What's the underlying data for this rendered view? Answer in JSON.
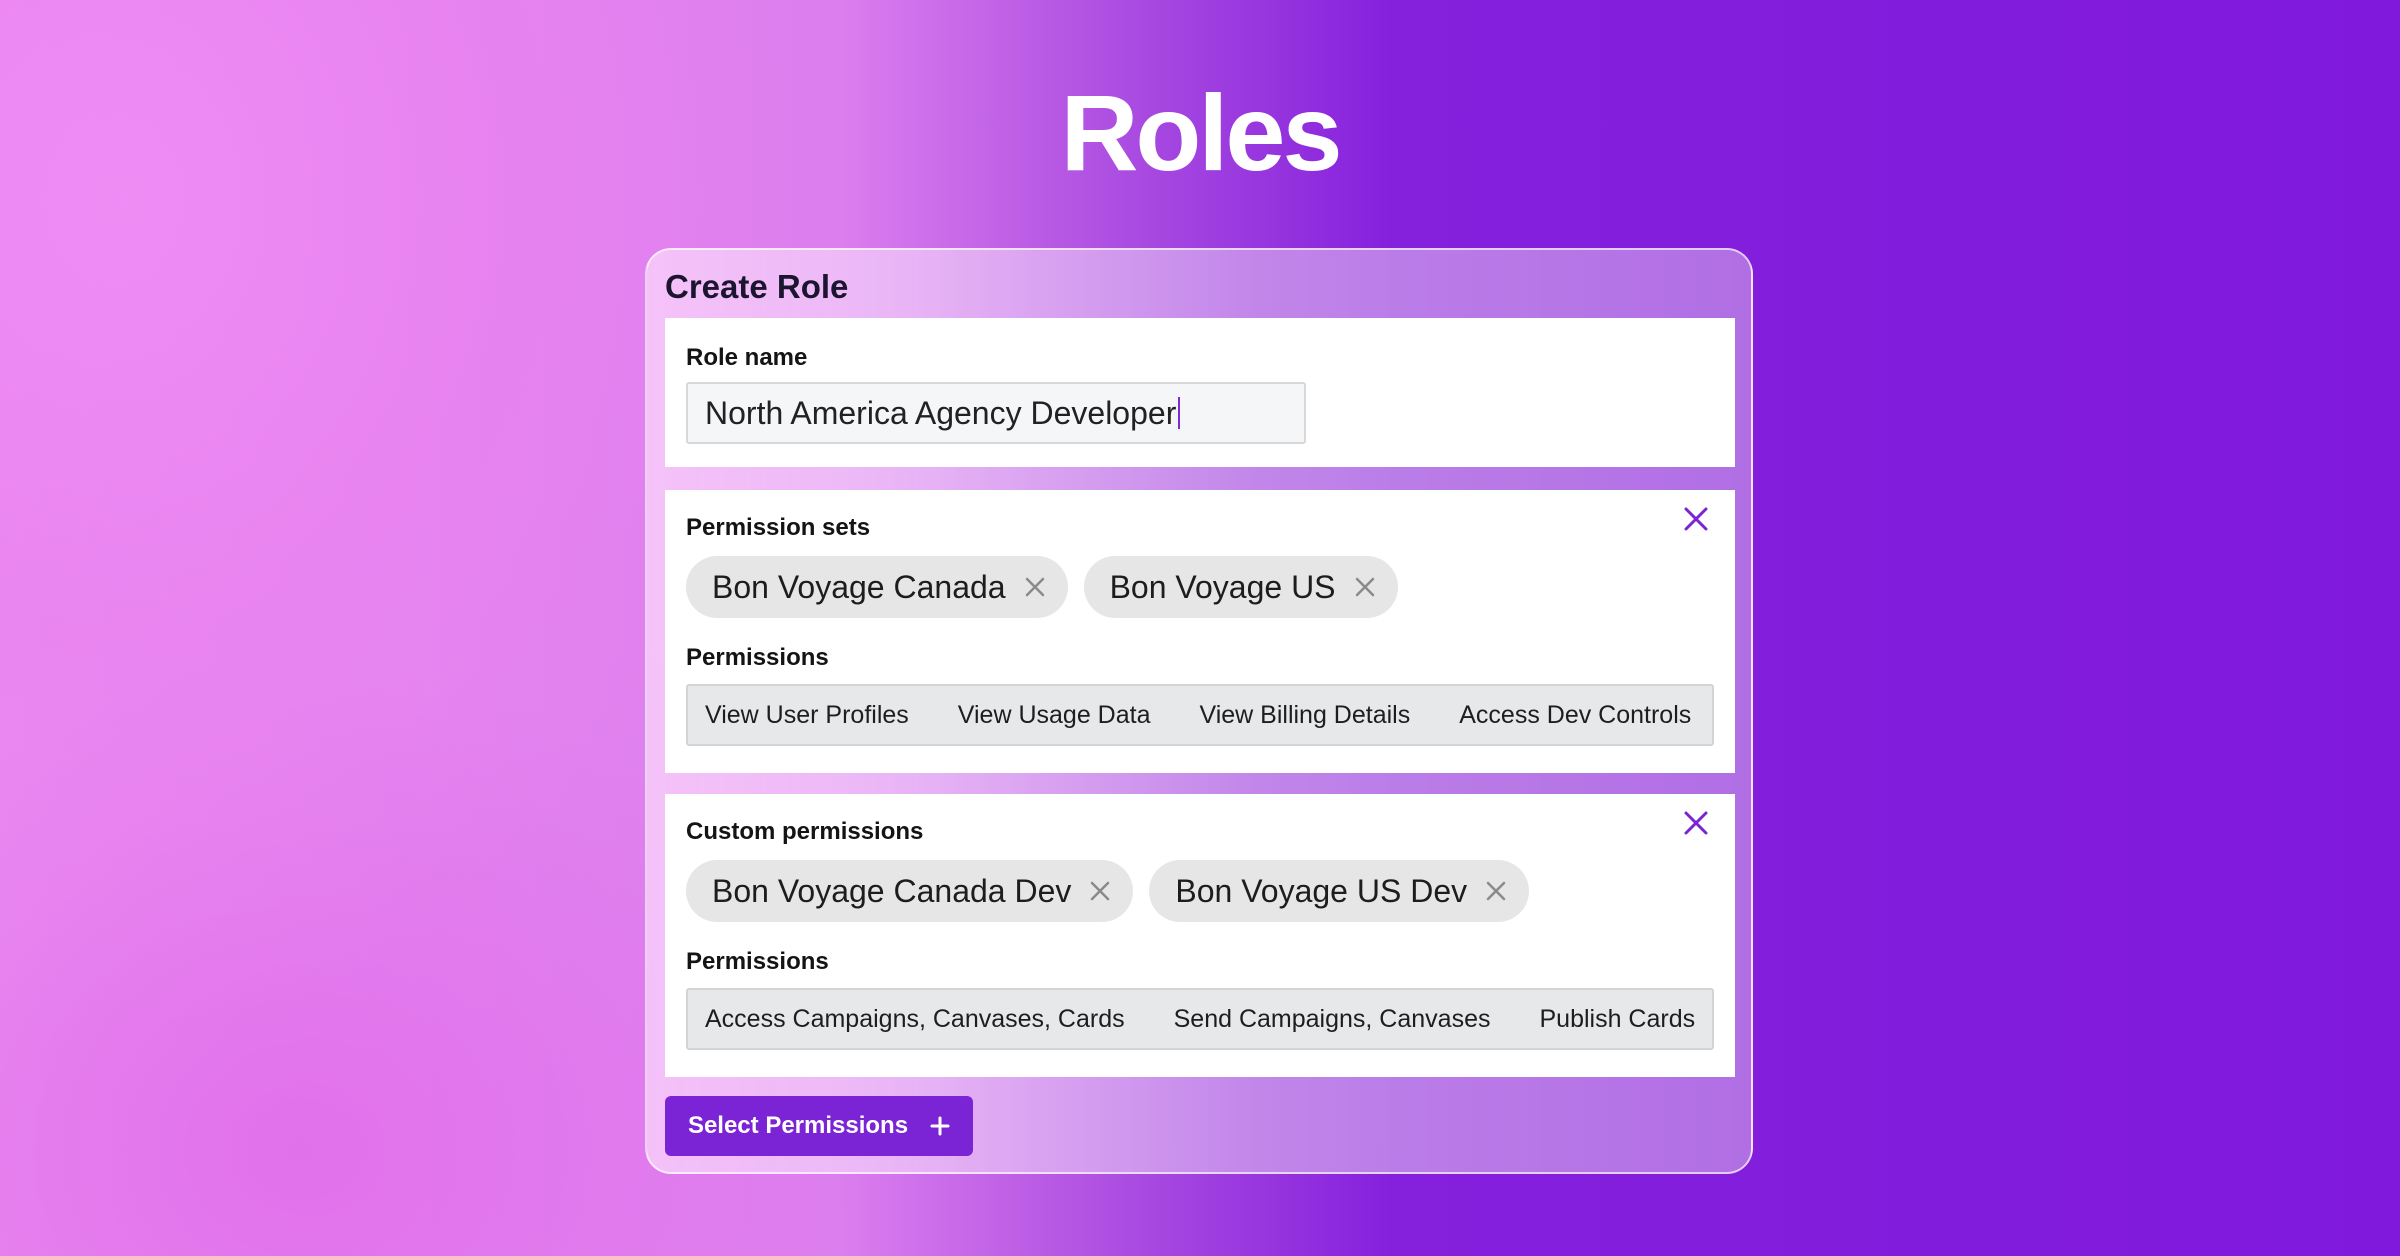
{
  "page": {
    "title": "Roles"
  },
  "create_role": {
    "title": "Create Role",
    "role_name": {
      "label": "Role name",
      "value": "North America Agency Developer"
    },
    "permission_sets": {
      "label": "Permission sets",
      "chips": [
        "Bon Voyage Canada",
        "Bon Voyage US"
      ],
      "permissions_label": "Permissions",
      "permissions": [
        "View User Profiles",
        "View Usage Data",
        "View Billing Details",
        "Access Dev Controls"
      ]
    },
    "custom_permissions": {
      "label": "Custom permissions",
      "chips": [
        "Bon Voyage Canada Dev",
        "Bon Voyage US Dev"
      ],
      "permissions_label": "Permissions",
      "permissions": [
        "Access Campaigns, Canvases, Cards",
        "Send Campaigns, Canvases",
        "Publish Cards"
      ]
    },
    "select_button": {
      "label": "Select Permissions",
      "icon": "plus-icon"
    }
  },
  "icons": {
    "panel_close": "close-icon",
    "chip_remove": "close-icon"
  },
  "colors": {
    "accent": "#7b24d6",
    "title_text": "#ffffff",
    "chip_bg": "#e6e6e6"
  }
}
